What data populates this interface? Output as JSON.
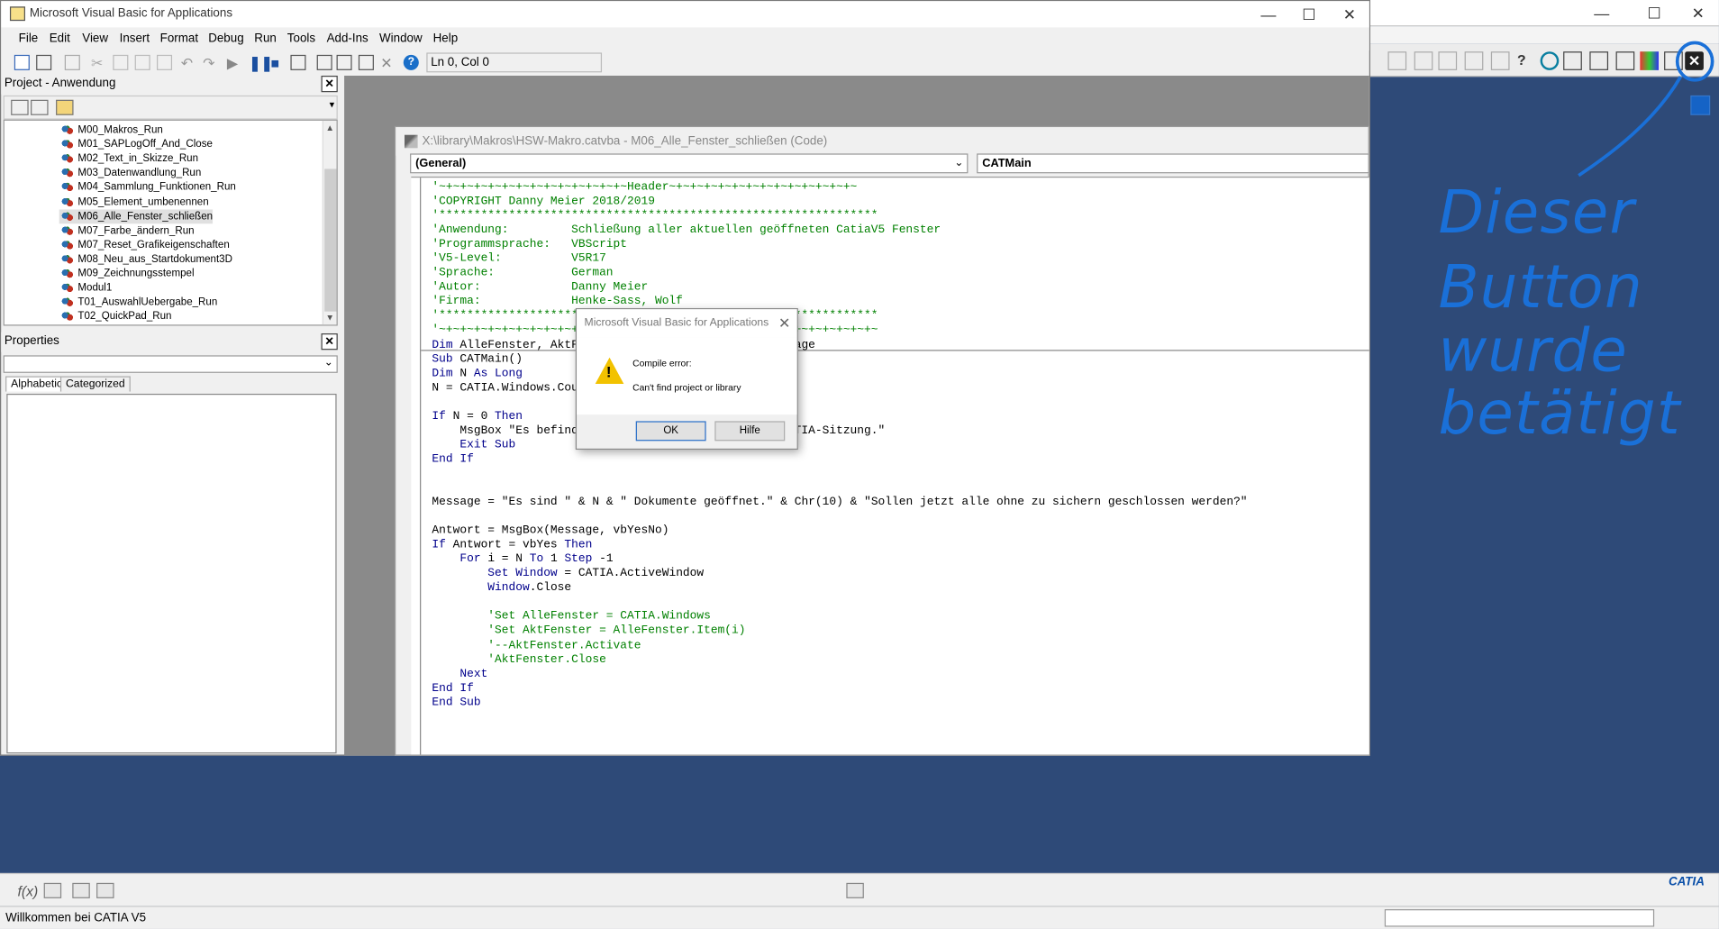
{
  "vba": {
    "title": "Microsoft Visual Basic for Applications",
    "menu": [
      "File",
      "Edit",
      "View",
      "Insert",
      "Format",
      "Debug",
      "Run",
      "Tools",
      "Add-Ins",
      "Window",
      "Help"
    ],
    "position": "Ln 0, Col 0"
  },
  "project": {
    "title": "Project - Anwendung",
    "items": [
      "M00_Makros_Run",
      "M01_SAPLogOff_And_Close",
      "M02_Text_in_Skizze_Run",
      "M03_Datenwandlung_Run",
      "M04_Sammlung_Funktionen_Run",
      "M05_Element_umbenennen",
      "M06_Alle_Fenster_schließen",
      "M07_Farbe_ändern_Run",
      "M07_Reset_Grafikeigenschaften",
      "M08_Neu_aus_Startdokument3D",
      "M09_Zeichnungsstempel",
      "Modul1",
      "T01_AuswahlUebergabe_Run",
      "T02_QuickPad_Run"
    ]
  },
  "properties": {
    "title": "Properties",
    "tabs": [
      "Alphabetic",
      "Categorized"
    ]
  },
  "code": {
    "title": "X:\\library\\Makros\\HSW-Makro.catvba - M06_Alle_Fenster_schließen (Code)",
    "object_combo": "(General)",
    "proc_combo": "CATMain",
    "lines": [
      "'~+~+~+~+~+~+~+~+~+~+~+~+~+~Header~+~+~+~+~+~+~+~+~+~+~+~+~+~",
      "'COPYRIGHT Danny Meier 2018/2019",
      "'***************************************************************",
      "'Anwendung:         Schließung aller aktuellen geöffneten CatiaV5 Fenster",
      "'Programmsprache:   VBScript",
      "'V5-Level:          V5R17",
      "'Sprache:           German",
      "'Autor:             Danny Meier",
      "'Firma:             Henke-Sass, Wolf",
      "'***************************************************************",
      "'~+~+~+~+~+~+~+~+~+~+~+~+~+~+~+~+~+~+~+~+~+~+~+~+~+~+~+~+~+~+~+~",
      "Dim AlleFenster, AktFenster As Window, Antwort, Message",
      "Sub CATMain()",
      "Dim N As Long",
      "N = CATIA.Windows.Count",
      "",
      "If N = 0 Then",
      "    MsgBox \"Es befinden sich keine Fenster in der CATIA-Sitzung.\"",
      "    Exit Sub",
      "End If",
      "",
      "",
      "Message = \"Es sind \" & N & \" Dokumente geöffnet.\" & Chr(10) & \"Sollen jetzt alle ohne zu sichern geschlossen werden?\"",
      "",
      "Antwort = MsgBox(Message, vbYesNo)",
      "If Antwort = vbYes Then",
      "    For i = N To 1 Step -1",
      "        Set Window = CATIA.ActiveWindow",
      "        Window.Close",
      "",
      "        'Set AlleFenster = CATIA.Windows",
      "        'Set AktFenster = AlleFenster.Item(i)",
      "        '--AktFenster.Activate",
      "        'AktFenster.Close",
      "    Next",
      "End If",
      "End Sub"
    ]
  },
  "dialog": {
    "title": "Microsoft Visual Basic for Applications",
    "line1": "Compile error:",
    "line2": "Can't find project or library",
    "ok": "OK",
    "help": "Hilfe"
  },
  "catia": {
    "status": "Willkommen bei CATIA V5",
    "logo": "CATIA"
  },
  "annotation": {
    "lines": [
      "Dieser",
      "Button",
      "wurde",
      "betätigt"
    ],
    "color": "#1a70d8"
  }
}
